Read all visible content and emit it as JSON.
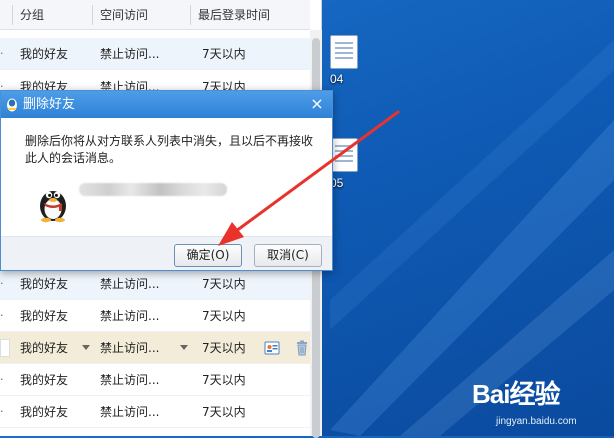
{
  "list": {
    "headers": {
      "group": "分组",
      "access": "空间访问",
      "last_login": "最后登录时间"
    },
    "rows": [
      {
        "group": "我的好友",
        "access": "禁止访问...",
        "last_login": "7天以内",
        "style": "alt"
      },
      {
        "group": "我的好友",
        "access": "禁止访问...",
        "last_login": "7天以内",
        "style": ""
      },
      {
        "group": "我的好友",
        "access": "禁止访问...",
        "last_login": "7天以内",
        "style": "alt"
      },
      {
        "group": "我的好友",
        "access": "禁止访问...",
        "last_login": "7天以内",
        "style": ""
      },
      {
        "group": "我的好友",
        "access": "禁止访问...",
        "last_login": "7天以内",
        "style": "hl"
      },
      {
        "group": "我的好友",
        "access": "禁止访问...",
        "last_login": "7天以内",
        "style": ""
      },
      {
        "group": "我的好友",
        "access": "禁止访问...",
        "last_login": "7天以内",
        "style": ""
      }
    ]
  },
  "dialog": {
    "title": "删除好友",
    "close_label": "×",
    "message": "删除后你将从对方联系人列表中消失，且以后不再接收此人的会话消息。",
    "confirm_label": "确定(O)",
    "cancel_label": "取消(C)"
  },
  "desktop": {
    "icon_labels": [
      "04",
      "05"
    ]
  },
  "watermark": {
    "logo": "Bai经验",
    "sub": "jingyan.baidu.com"
  },
  "colors": {
    "title_bar": "#3a8ddc",
    "annotation": "#e8322b",
    "desktop": "#1565c0"
  }
}
